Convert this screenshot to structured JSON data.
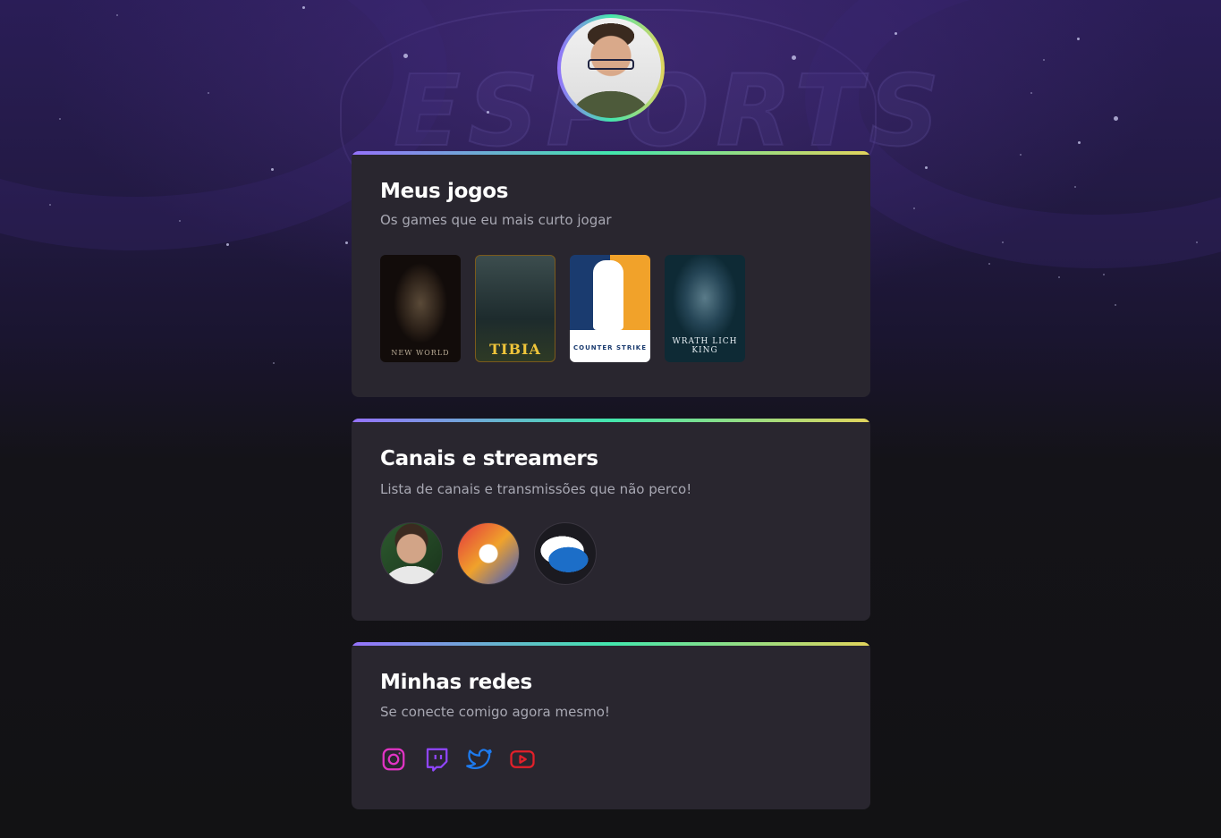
{
  "profile": {
    "avatar_alt": "Foto de perfil"
  },
  "games_card": {
    "title": "Meus jogos",
    "subtitle": "Os games que eu mais curto jogar",
    "games": [
      {
        "name": "new-world",
        "cover_text": "NEW WORLD"
      },
      {
        "name": "tibia",
        "cover_text": "TIBIA"
      },
      {
        "name": "counter-strike",
        "cover_text": "COUNTER STRIKE"
      },
      {
        "name": "wow-lich-king",
        "cover_text": "WRATH LICH KING"
      }
    ]
  },
  "streamers_card": {
    "title": "Canais e streamers",
    "subtitle": "Lista de canais e transmissões que não perco!"
  },
  "social_card": {
    "title": "Minhas redes",
    "subtitle": "Se conecte comigo agora mesmo!",
    "icons": [
      "instagram-icon",
      "twitch-icon",
      "twitter-icon",
      "youtube-icon"
    ]
  },
  "colors": {
    "accent_gradient": [
      "#9572fc",
      "#43e7ad",
      "#e2d45c"
    ],
    "card_bg": "#29262f",
    "instagram": "#e234c5",
    "twitch": "#9146ff",
    "twitter": "#1d7bf0",
    "youtube": "#e3202a"
  }
}
